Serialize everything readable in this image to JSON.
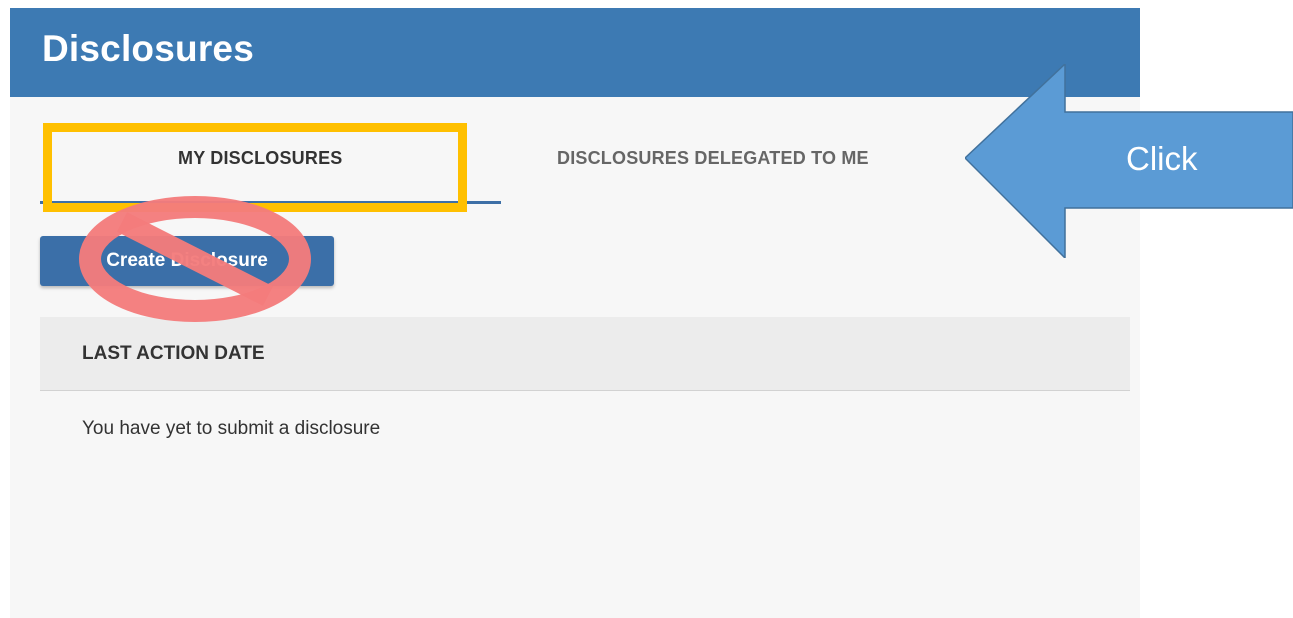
{
  "header": {
    "title": "Disclosures"
  },
  "tabs": [
    {
      "label": "MY DISCLOSURES",
      "active": true
    },
    {
      "label": "DISCLOSURES DELEGATED TO ME",
      "active": false
    }
  ],
  "actions": {
    "create_label": "Create Disclosure"
  },
  "table": {
    "columns": [
      "LAST ACTION DATE"
    ],
    "empty_message": "You have yet to submit a disclosure"
  },
  "annotations": {
    "arrow_label": "Click",
    "highlight_color": "#ffc000",
    "prohibit_color": "#f47c7c",
    "arrow_color": "#5b9bd5"
  },
  "colors": {
    "header_bg": "#3d7ab3",
    "button_bg": "#3b6fa8",
    "page_bg": "#f7f7f7"
  }
}
